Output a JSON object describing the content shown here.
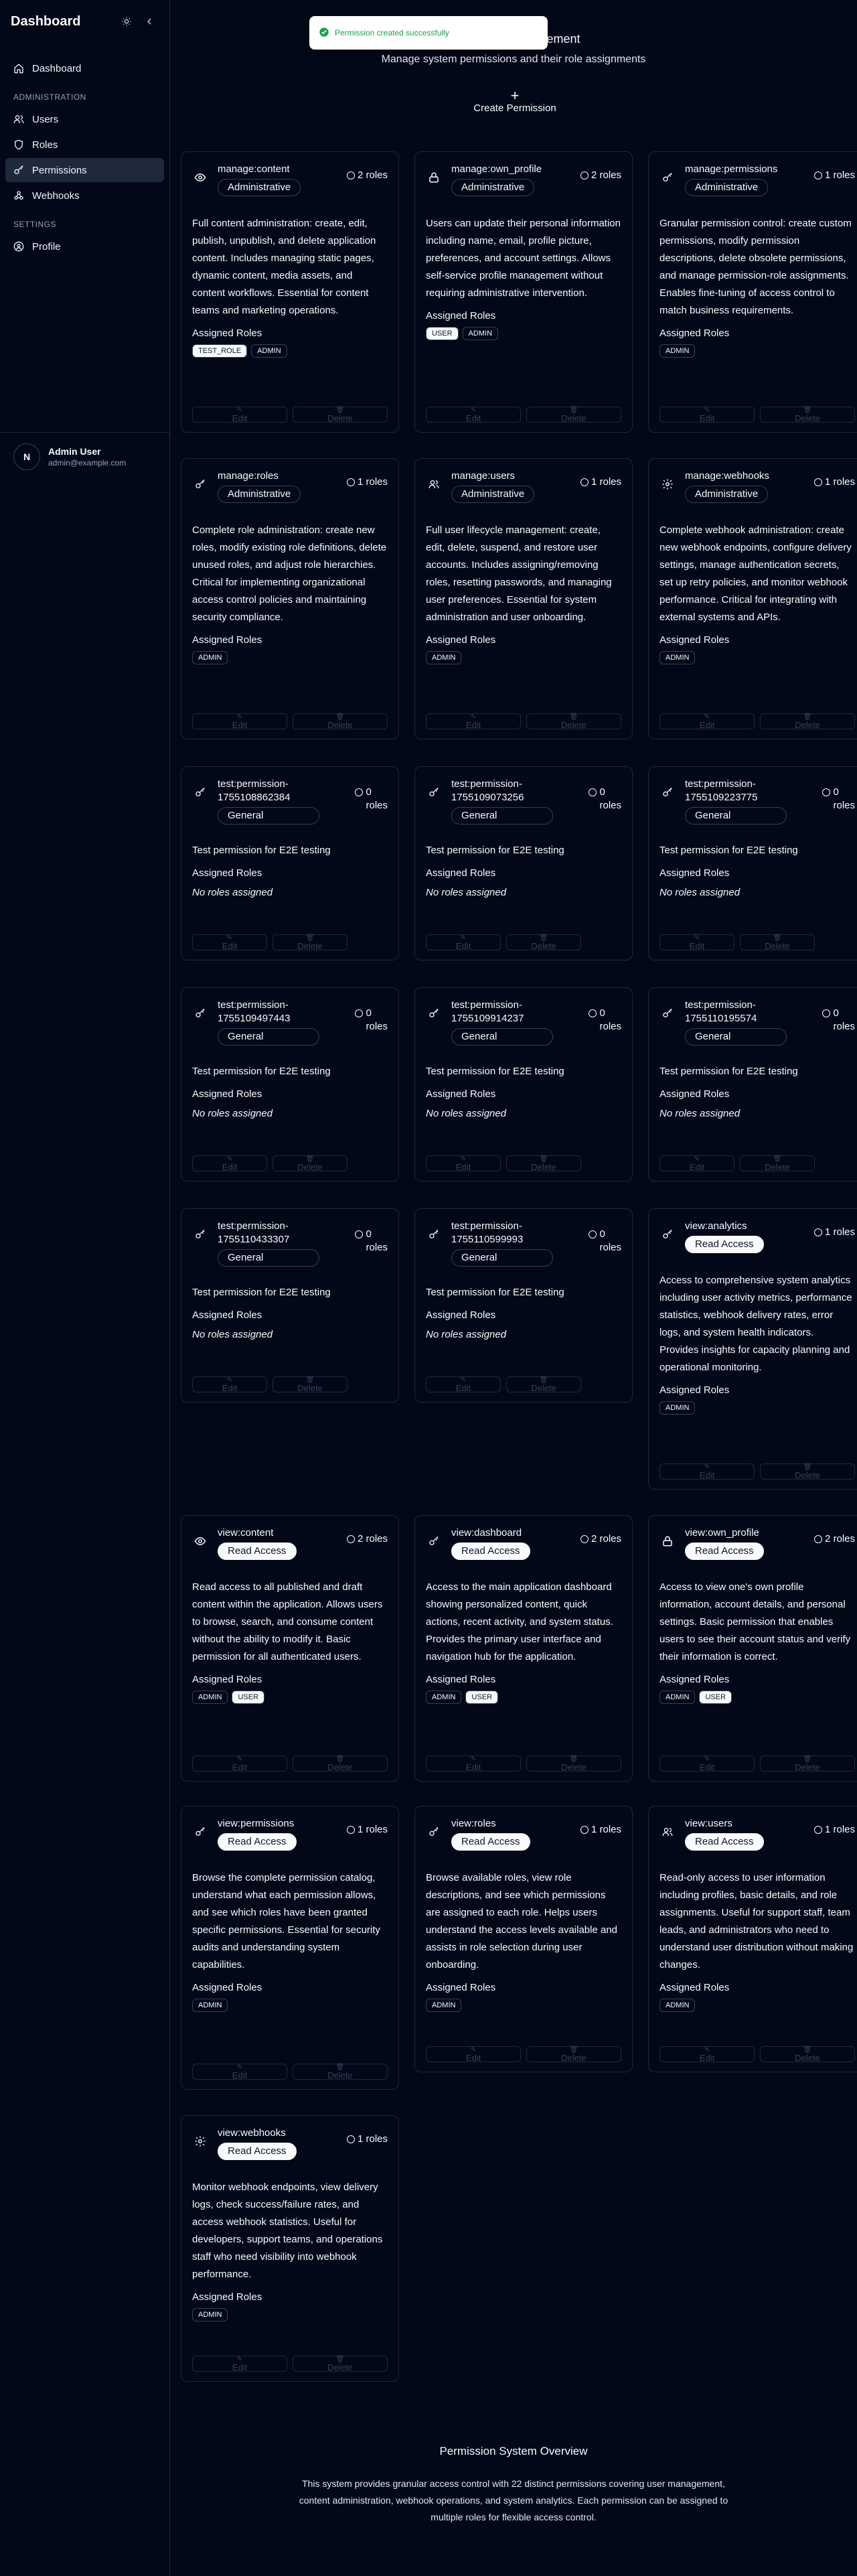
{
  "app": {
    "title": "Dashboard"
  },
  "sidebar": {
    "nav": [
      {
        "label": "Dashboard",
        "icon": "home-icon"
      }
    ],
    "admin_section": "ADMINISTRATION",
    "admin_items": [
      {
        "label": "Users",
        "icon": "users-icon"
      },
      {
        "label": "Roles",
        "icon": "shield-icon"
      },
      {
        "label": "Permissions",
        "icon": "key-icon",
        "active": true
      },
      {
        "label": "Webhooks",
        "icon": "webhook-icon"
      }
    ],
    "settings_section": "SETTINGS",
    "settings_items": [
      {
        "label": "Profile",
        "icon": "user-circle-icon"
      }
    ],
    "user": {
      "initial": "N",
      "name": "Admin User",
      "email": "admin@example.com"
    }
  },
  "toast": {
    "message": "Permission created successfully"
  },
  "header": {
    "title": "Permission Management",
    "subtitle": "Manage system permissions and their role assignments",
    "create_label": "Create Permission"
  },
  "labels": {
    "assigned_roles": "Assigned Roles",
    "no_roles": "No roles assigned",
    "edit": "Edit",
    "delete": "Delete"
  },
  "permissions": [
    {
      "name": "manage:content",
      "category": "Administrative",
      "count": "2 roles",
      "icon": "eye-icon",
      "description": "Full content administration: create, edit, publish, unpublish, and delete application content. Includes managing static pages, dynamic content, media assets, and content workflows. Essential for content teams and marketing operations.",
      "roles": [
        "TEST_ROLE",
        "ADMIN"
      ]
    },
    {
      "name": "manage:own_profile",
      "category": "Administrative",
      "count": "2 roles",
      "icon": "lock-icon",
      "description": "Users can update their personal information including name, email, profile picture, preferences, and account settings. Allows self-service profile management without requiring administrative intervention.",
      "roles": [
        "USER",
        "ADMIN"
      ]
    },
    {
      "name": "manage:permissions",
      "category": "Administrative",
      "count": "1 roles",
      "icon": "key-icon",
      "description": "Granular permission control: create custom permissions, modify permission descriptions, delete obsolete permissions, and manage permission-role assignments. Enables fine-tuning of access control to match business requirements.",
      "roles": [
        "ADMIN"
      ]
    },
    {
      "name": "manage:roles",
      "category": "Administrative",
      "count": "1 roles",
      "icon": "key-icon",
      "description": "Complete role administration: create new roles, modify existing role definitions, delete unused roles, and adjust role hierarchies. Critical for implementing organizational access control policies and maintaining security compliance.",
      "roles": [
        "ADMIN"
      ]
    },
    {
      "name": "manage:users",
      "category": "Administrative",
      "count": "1 roles",
      "icon": "users-icon",
      "description": "Full user lifecycle management: create, edit, delete, suspend, and restore user accounts. Includes assigning/removing roles, resetting passwords, and managing user preferences. Essential for system administration and user onboarding.",
      "roles": [
        "ADMIN"
      ]
    },
    {
      "name": "manage:webhooks",
      "category": "Administrative",
      "count": "1 roles",
      "icon": "gear-icon",
      "description": "Complete webhook administration: create new webhook endpoints, configure delivery settings, manage authentication secrets, set up retry policies, and monitor webhook performance. Critical for integrating with external systems and APIs.",
      "roles": [
        "ADMIN"
      ]
    },
    {
      "name_l1": "test:permission-",
      "name_l2": "1755108862384",
      "category": "General",
      "count_num": "0",
      "count_word": "roles",
      "icon": "key-icon",
      "description": "Test permission for E2E testing",
      "roles": []
    },
    {
      "name_l1": "test:permission-",
      "name_l2": "1755109073256",
      "category": "General",
      "count_num": "0",
      "count_word": "roles",
      "icon": "key-icon",
      "description": "Test permission for E2E testing",
      "roles": []
    },
    {
      "name_l1": "test:permission-",
      "name_l2": "1755109223775",
      "category": "General",
      "count_num": "0",
      "count_word": "roles",
      "icon": "key-icon",
      "description": "Test permission for E2E testing",
      "roles": []
    },
    {
      "name_l1": "test:permission-",
      "name_l2": "1755109497443",
      "category": "General",
      "count_num": "0",
      "count_word": "roles",
      "icon": "key-icon",
      "description": "Test permission for E2E testing",
      "roles": []
    },
    {
      "name_l1": "test:permission-",
      "name_l2": "1755109914237",
      "category": "General",
      "count_num": "0",
      "count_word": "roles",
      "icon": "key-icon",
      "description": "Test permission for E2E testing",
      "roles": []
    },
    {
      "name_l1": "test:permission-",
      "name_l2": "1755110195574",
      "category": "General",
      "count_num": "0",
      "count_word": "roles",
      "icon": "key-icon",
      "description": "Test permission for E2E testing",
      "roles": []
    },
    {
      "name_l1": "test:permission-",
      "name_l2": "1755110433307",
      "category": "General",
      "count_num": "0",
      "count_word": "roles",
      "icon": "key-icon",
      "description": "Test permission for E2E testing",
      "roles": []
    },
    {
      "name_l1": "test:permission-",
      "name_l2": "1755110599993",
      "category": "General",
      "count_num": "0",
      "count_word": "roles",
      "icon": "key-icon",
      "description": "Test permission for E2E testing",
      "roles": []
    },
    {
      "name": "view:analytics",
      "category": "Read Access",
      "count": "1 roles",
      "icon": "key-icon",
      "description": "Access to comprehensive system analytics including user activity metrics, performance statistics, webhook delivery rates, error logs, and system health indicators. Provides insights for capacity planning and operational monitoring.",
      "roles": [
        "ADMIN"
      ]
    },
    {
      "name": "view:content",
      "category": "Read Access",
      "count": "2 roles",
      "icon": "eye-icon",
      "description": "Read access to all published and draft content within the application. Allows users to browse, search, and consume content without the ability to modify it. Basic permission for all authenticated users.",
      "roles": [
        "ADMIN",
        "USER"
      ]
    },
    {
      "name": "view:dashboard",
      "category": "Read Access",
      "count": "2 roles",
      "icon": "key-icon",
      "description": "Access to the main application dashboard showing personalized content, quick actions, recent activity, and system status. Provides the primary user interface and navigation hub for the application.",
      "roles": [
        "ADMIN",
        "USER"
      ]
    },
    {
      "name": "view:own_profile",
      "category": "Read Access",
      "count": "2 roles",
      "icon": "lock-icon",
      "description": "Access to view one's own profile information, account details, and personal settings. Basic permission that enables users to see their account status and verify their information is correct.",
      "roles": [
        "ADMIN",
        "USER"
      ]
    },
    {
      "name": "view:permissions",
      "category": "Read Access",
      "count": "1 roles",
      "icon": "key-icon",
      "description": "Browse the complete permission catalog, understand what each permission allows, and see which roles have been granted specific permissions. Essential for security audits and understanding system capabilities.",
      "roles": [
        "ADMIN"
      ]
    },
    {
      "name": "view:roles",
      "category": "Read Access",
      "count": "1 roles",
      "icon": "key-icon",
      "description": "Browse available roles, view role descriptions, and see which permissions are assigned to each role. Helps users understand the access levels available and assists in role selection during user onboarding.",
      "roles": [
        "ADMIN"
      ]
    },
    {
      "name": "view:users",
      "category": "Read Access",
      "count": "1 roles",
      "icon": "users-icon",
      "description": "Read-only access to user information including profiles, basic details, and role assignments. Useful for support staff, team leads, and administrators who need to understand user distribution without making changes.",
      "roles": [
        "ADMIN"
      ]
    },
    {
      "name": "view:webhooks",
      "category": "Read Access",
      "count": "1 roles",
      "icon": "gear-icon",
      "description": "Monitor webhook endpoints, view delivery logs, check success/failure rates, and access webhook statistics. Useful for developers, support teams, and operations staff who need visibility into webhook performance.",
      "roles": [
        "ADMIN"
      ]
    }
  ],
  "overview": {
    "title": "Permission System Overview",
    "text": "This system provides granular access control with 22 distinct permissions covering user management, content administration, webhook operations, and system analytics. Each permission can be assigned to multiple roles for flexible access control."
  }
}
